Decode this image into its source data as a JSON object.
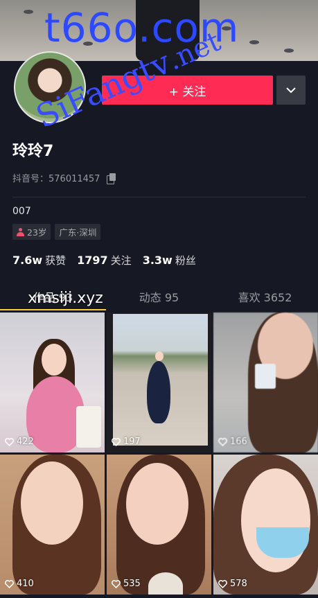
{
  "watermarks": {
    "top": "t66o.com",
    "diagonal_main": "SiFangtv",
    "diagonal_net": ".net",
    "grid": "xmsiji.xyz"
  },
  "profile": {
    "name": "玲玲7",
    "douyin_id": "抖音号：576011457",
    "bio": "007",
    "tags": [
      "23岁",
      "广东·深圳"
    ],
    "follow_label": "+ 关注"
  },
  "stats": [
    {
      "value": "7.6w",
      "label": "获赞"
    },
    {
      "value": "1797",
      "label": "关注"
    },
    {
      "value": "3.3w",
      "label": "粉丝"
    }
  ],
  "tabs": [
    {
      "label": "作品 93"
    },
    {
      "label": "动态 95"
    },
    {
      "label": "喜欢 3652"
    }
  ],
  "videos": [
    {
      "likes": "422"
    },
    {
      "likes": "197"
    },
    {
      "likes": "166"
    },
    {
      "likes": "410"
    },
    {
      "likes": "535"
    },
    {
      "likes": "578"
    }
  ],
  "colors": {
    "background": "#161823",
    "follow_button": "#fe2c55",
    "active_tab_indicator": "#facd3c",
    "tag_icon": "#f1506f"
  },
  "icons": [
    "chevron-down-icon",
    "copy-icon",
    "person-icon",
    "heart-icon"
  ]
}
